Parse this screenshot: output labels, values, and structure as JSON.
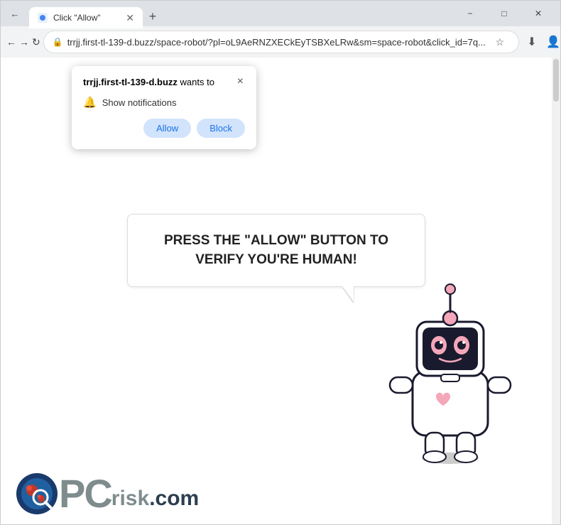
{
  "browser": {
    "tab": {
      "title": "Click \"Allow\""
    },
    "address": "trrjj.first-tl-139-d.buzz/space-robot/?pl=oL9AeRNZXECkEyTSBXeLRw&sm=space-robot&click_id=7q..."
  },
  "notification_popup": {
    "site_name": "trrjj.first-tl-139-d.buzz",
    "wants_text": " wants to",
    "notification_label": "Show notifications",
    "close_label": "×",
    "allow_label": "Allow",
    "block_label": "Block"
  },
  "page": {
    "speech_bubble_text": "PRESS THE \"ALLOW\" BUTTON TO VERIFY YOU'RE HUMAN!"
  },
  "logo": {
    "pc_text": "PC",
    "risk_text": "risk",
    "dot_com": ".com"
  },
  "nav": {
    "back_label": "←",
    "forward_label": "→",
    "reload_label": "↻"
  },
  "titlebar": {
    "minimize": "−",
    "maximize": "□",
    "close": "✕"
  }
}
